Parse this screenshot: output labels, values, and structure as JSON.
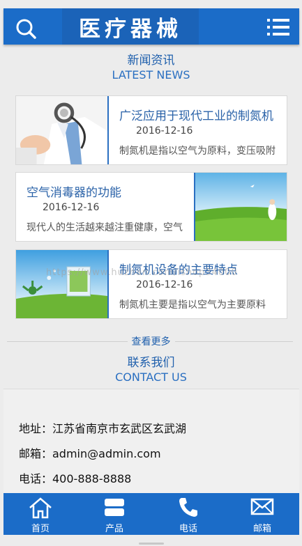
{
  "header": {
    "logo_text": "医疗器械",
    "search_icon": "search-icon",
    "menu_icon": "menu-icon"
  },
  "news_section": {
    "title_cn": "新闻资讯",
    "title_en": "LATEST NEWS"
  },
  "news": [
    {
      "title": "广泛应用于现代工业的制氮机",
      "date": "2016-12-16",
      "excerpt": "制氮机是指以空气为原料，变压吸附"
    },
    {
      "title": "空气消毒器的功能",
      "date": "2016-12-16",
      "excerpt": "现代人的生活越来越注重健康，空气"
    },
    {
      "title": "制氮机设备的主要特点",
      "date": "2016-12-16",
      "excerpt": "制氮机主要是指以空气为主要原料"
    }
  ],
  "watermark": "https://www.huzhan.com/ishop34000",
  "more_label": "查看更多",
  "contact_section": {
    "title_cn": "联系我们",
    "title_en": "CONTACT US"
  },
  "contact": {
    "address": "地址：江苏省南京市玄武区玄武湖",
    "email": "邮箱：admin@admin.com",
    "phone": "电话：400-888-8888"
  },
  "footer": [
    {
      "label": "首页",
      "icon": "home-icon"
    },
    {
      "label": "产品",
      "icon": "products-icon"
    },
    {
      "label": "电话",
      "icon": "phone-icon"
    },
    {
      "label": "邮箱",
      "icon": "mail-icon"
    }
  ],
  "colors": {
    "primary": "#1b6cc8",
    "heading": "#2060ad",
    "background": "#ececec"
  }
}
